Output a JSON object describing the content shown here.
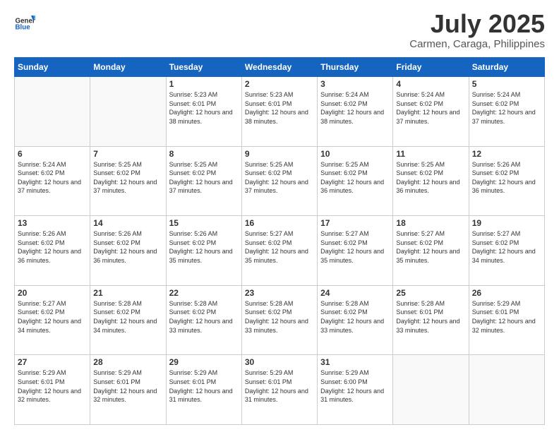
{
  "header": {
    "logo_general": "General",
    "logo_blue": "Blue",
    "month": "July 2025",
    "location": "Carmen, Caraga, Philippines"
  },
  "days_of_week": [
    "Sunday",
    "Monday",
    "Tuesday",
    "Wednesday",
    "Thursday",
    "Friday",
    "Saturday"
  ],
  "weeks": [
    [
      {
        "day": "",
        "info": ""
      },
      {
        "day": "",
        "info": ""
      },
      {
        "day": "1",
        "info": "Sunrise: 5:23 AM\nSunset: 6:01 PM\nDaylight: 12 hours and 38 minutes."
      },
      {
        "day": "2",
        "info": "Sunrise: 5:23 AM\nSunset: 6:01 PM\nDaylight: 12 hours and 38 minutes."
      },
      {
        "day": "3",
        "info": "Sunrise: 5:24 AM\nSunset: 6:02 PM\nDaylight: 12 hours and 38 minutes."
      },
      {
        "day": "4",
        "info": "Sunrise: 5:24 AM\nSunset: 6:02 PM\nDaylight: 12 hours and 37 minutes."
      },
      {
        "day": "5",
        "info": "Sunrise: 5:24 AM\nSunset: 6:02 PM\nDaylight: 12 hours and 37 minutes."
      }
    ],
    [
      {
        "day": "6",
        "info": "Sunrise: 5:24 AM\nSunset: 6:02 PM\nDaylight: 12 hours and 37 minutes."
      },
      {
        "day": "7",
        "info": "Sunrise: 5:25 AM\nSunset: 6:02 PM\nDaylight: 12 hours and 37 minutes."
      },
      {
        "day": "8",
        "info": "Sunrise: 5:25 AM\nSunset: 6:02 PM\nDaylight: 12 hours and 37 minutes."
      },
      {
        "day": "9",
        "info": "Sunrise: 5:25 AM\nSunset: 6:02 PM\nDaylight: 12 hours and 37 minutes."
      },
      {
        "day": "10",
        "info": "Sunrise: 5:25 AM\nSunset: 6:02 PM\nDaylight: 12 hours and 36 minutes."
      },
      {
        "day": "11",
        "info": "Sunrise: 5:25 AM\nSunset: 6:02 PM\nDaylight: 12 hours and 36 minutes."
      },
      {
        "day": "12",
        "info": "Sunrise: 5:26 AM\nSunset: 6:02 PM\nDaylight: 12 hours and 36 minutes."
      }
    ],
    [
      {
        "day": "13",
        "info": "Sunrise: 5:26 AM\nSunset: 6:02 PM\nDaylight: 12 hours and 36 minutes."
      },
      {
        "day": "14",
        "info": "Sunrise: 5:26 AM\nSunset: 6:02 PM\nDaylight: 12 hours and 36 minutes."
      },
      {
        "day": "15",
        "info": "Sunrise: 5:26 AM\nSunset: 6:02 PM\nDaylight: 12 hours and 35 minutes."
      },
      {
        "day": "16",
        "info": "Sunrise: 5:27 AM\nSunset: 6:02 PM\nDaylight: 12 hours and 35 minutes."
      },
      {
        "day": "17",
        "info": "Sunrise: 5:27 AM\nSunset: 6:02 PM\nDaylight: 12 hours and 35 minutes."
      },
      {
        "day": "18",
        "info": "Sunrise: 5:27 AM\nSunset: 6:02 PM\nDaylight: 12 hours and 35 minutes."
      },
      {
        "day": "19",
        "info": "Sunrise: 5:27 AM\nSunset: 6:02 PM\nDaylight: 12 hours and 34 minutes."
      }
    ],
    [
      {
        "day": "20",
        "info": "Sunrise: 5:27 AM\nSunset: 6:02 PM\nDaylight: 12 hours and 34 minutes."
      },
      {
        "day": "21",
        "info": "Sunrise: 5:28 AM\nSunset: 6:02 PM\nDaylight: 12 hours and 34 minutes."
      },
      {
        "day": "22",
        "info": "Sunrise: 5:28 AM\nSunset: 6:02 PM\nDaylight: 12 hours and 33 minutes."
      },
      {
        "day": "23",
        "info": "Sunrise: 5:28 AM\nSunset: 6:02 PM\nDaylight: 12 hours and 33 minutes."
      },
      {
        "day": "24",
        "info": "Sunrise: 5:28 AM\nSunset: 6:02 PM\nDaylight: 12 hours and 33 minutes."
      },
      {
        "day": "25",
        "info": "Sunrise: 5:28 AM\nSunset: 6:01 PM\nDaylight: 12 hours and 33 minutes."
      },
      {
        "day": "26",
        "info": "Sunrise: 5:29 AM\nSunset: 6:01 PM\nDaylight: 12 hours and 32 minutes."
      }
    ],
    [
      {
        "day": "27",
        "info": "Sunrise: 5:29 AM\nSunset: 6:01 PM\nDaylight: 12 hours and 32 minutes."
      },
      {
        "day": "28",
        "info": "Sunrise: 5:29 AM\nSunset: 6:01 PM\nDaylight: 12 hours and 32 minutes."
      },
      {
        "day": "29",
        "info": "Sunrise: 5:29 AM\nSunset: 6:01 PM\nDaylight: 12 hours and 31 minutes."
      },
      {
        "day": "30",
        "info": "Sunrise: 5:29 AM\nSunset: 6:01 PM\nDaylight: 12 hours and 31 minutes."
      },
      {
        "day": "31",
        "info": "Sunrise: 5:29 AM\nSunset: 6:00 PM\nDaylight: 12 hours and 31 minutes."
      },
      {
        "day": "",
        "info": ""
      },
      {
        "day": "",
        "info": ""
      }
    ]
  ]
}
